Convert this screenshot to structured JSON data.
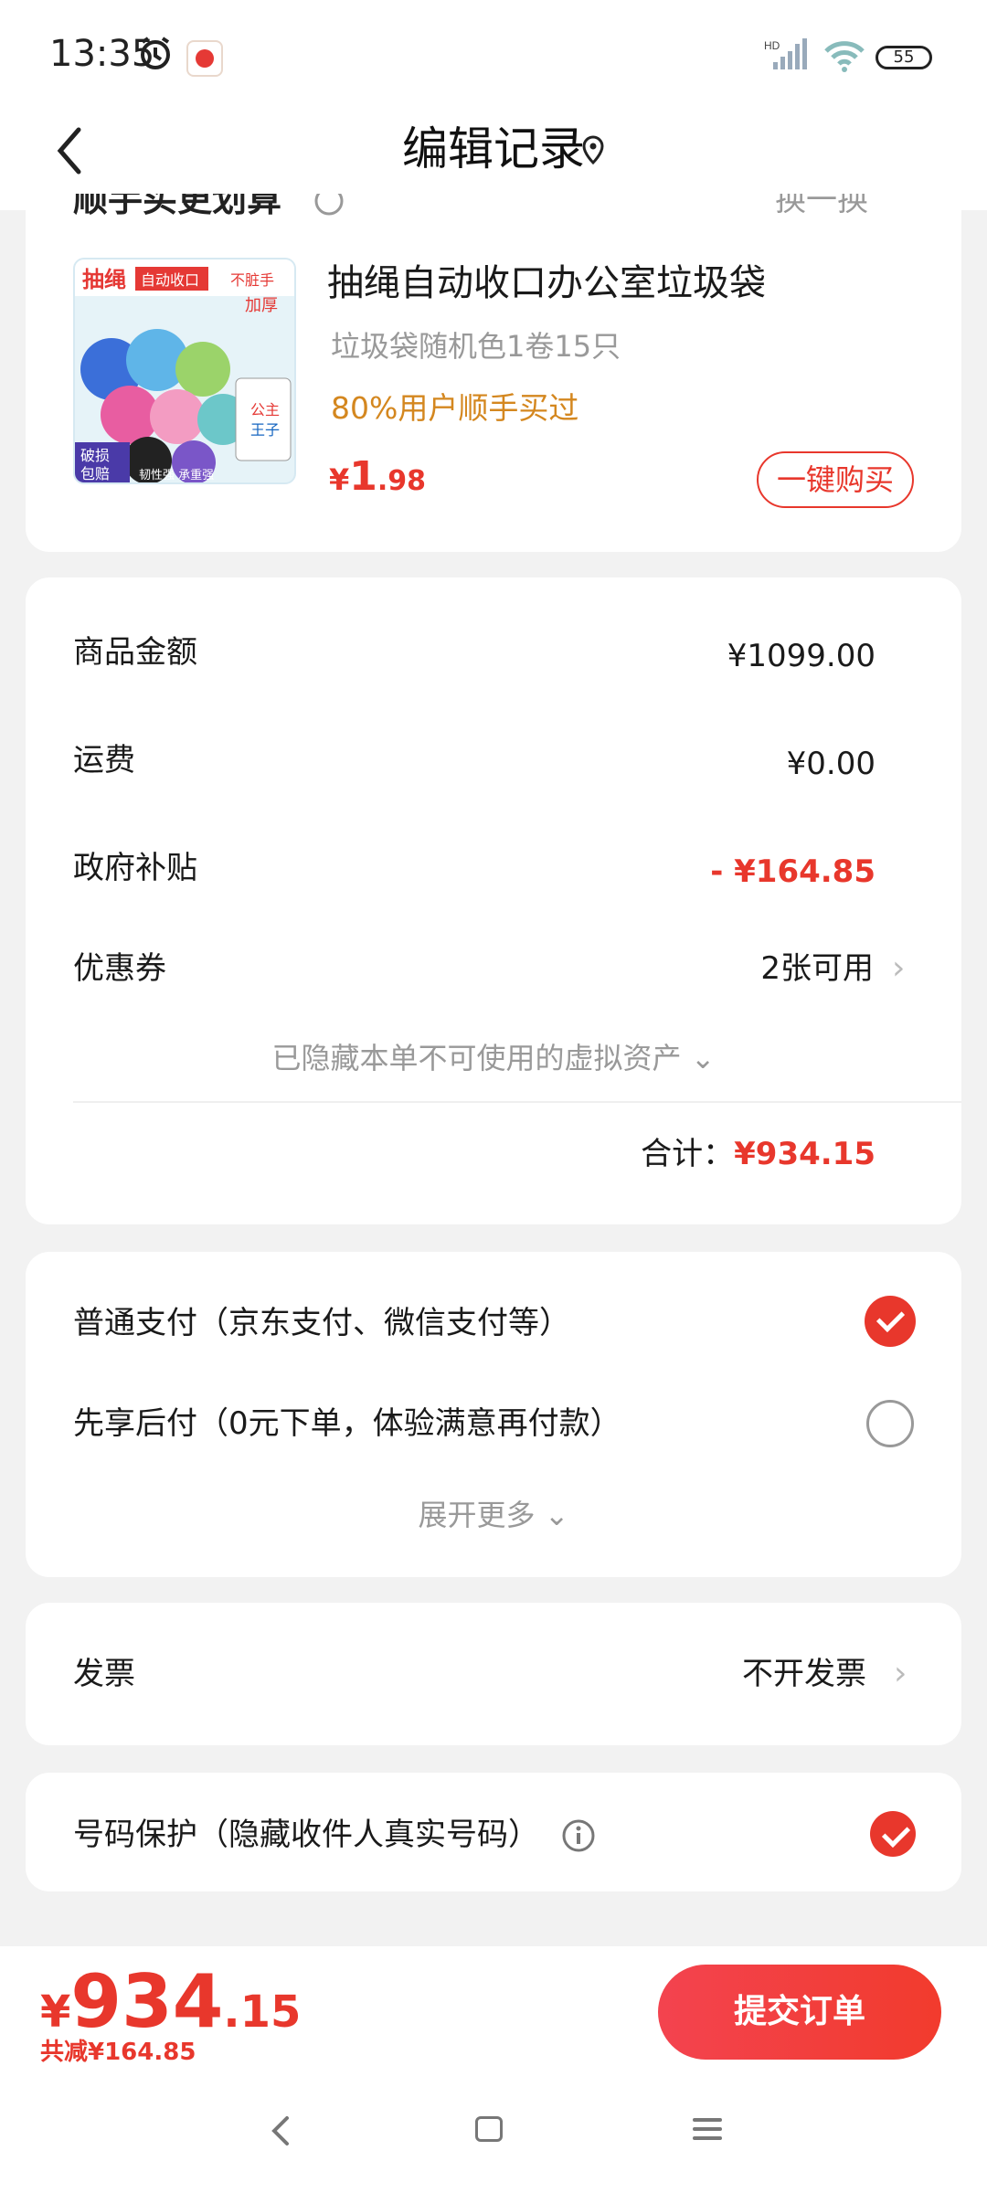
{
  "status_bar": {
    "time": "13:35",
    "battery": "55"
  },
  "header": {
    "title": "编辑记录"
  },
  "upsell": {
    "section_title": "顺手买更划算",
    "swap_label": "换一换",
    "product": {
      "name": "抽绳自动收口办公室垃圾袋",
      "spec": "垃圾袋随机色1卷15只",
      "tag": "80%用户顺手买过",
      "price_symbol": "¥",
      "price_int": "1",
      "price_dec": ".98",
      "buy_label": "一键购买"
    }
  },
  "summary": {
    "rows": [
      {
        "label": "商品金额",
        "value": "¥1099.00"
      },
      {
        "label": "运费",
        "value": "¥0.00"
      },
      {
        "label": "政府补贴",
        "value": "- ¥164.85"
      },
      {
        "label": "优惠券",
        "value": "2张可用"
      }
    ],
    "hidden_assets": "已隐藏本单不可使用的虚拟资产",
    "total_label": "合计：",
    "total_value": "¥934.15"
  },
  "payment": {
    "options": [
      {
        "label": "普通支付（京东支付、微信支付等）",
        "selected": true
      },
      {
        "label": "先享后付（0元下单，体验满意再付款）",
        "selected": false
      }
    ],
    "expand_label": "展开更多"
  },
  "invoice": {
    "label": "发票",
    "value": "不开发票"
  },
  "phone_protect": {
    "label": "号码保护（隐藏收件人真实号码）",
    "enabled": true
  },
  "footer": {
    "price_symbol": "¥",
    "price_int": "934",
    "price_dec": ".15",
    "saved": "共减¥164.85",
    "submit_label": "提交订单"
  },
  "colors": {
    "accent": "#e8372c",
    "tag": "#d4871f",
    "muted": "#999999",
    "background": "#f2f2f2"
  }
}
